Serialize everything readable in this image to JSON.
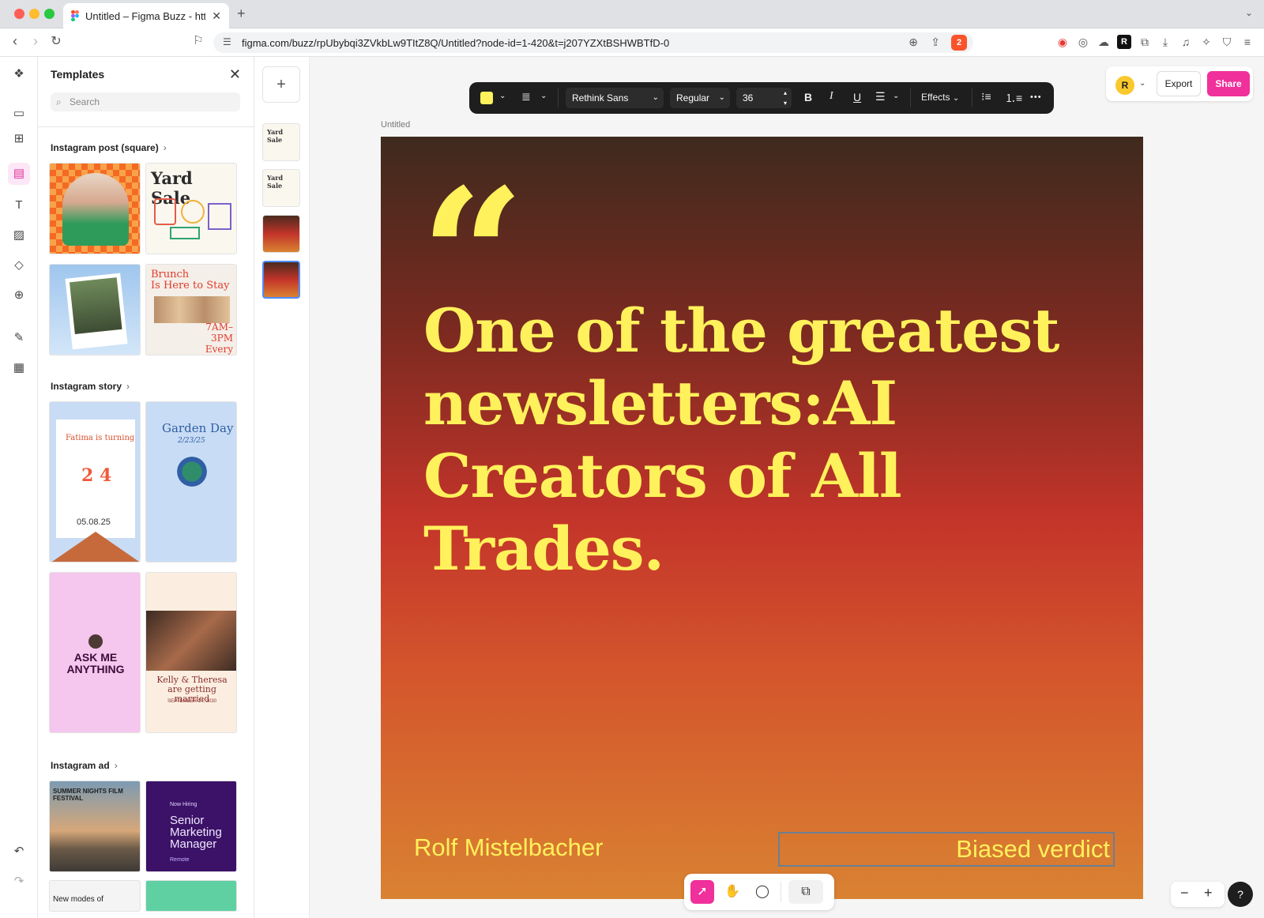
{
  "browser": {
    "tab_title": "Untitled – Figma Buzz - https",
    "url": "figma.com/buzz/rpUbybqi3ZVkbLw9TItZ8Q/Untitled?node-id=1-420&t=j207YZXtBSHWBTfD-0",
    "brave_badge": "2"
  },
  "templates_panel": {
    "title": "Templates",
    "search_placeholder": "Search",
    "sections": {
      "instagram_post": "Instagram post (square)",
      "instagram_story": "Instagram story",
      "instagram_ad": "Instagram ad"
    },
    "thumb_texts": {
      "yard_sale": "Yard Sale",
      "brunch_line1": "Brunch",
      "brunch_line2": "Is Here to Stay",
      "brunch_time": "7AM–3PM",
      "brunch_day": "Every Saturday",
      "fatima": "Fatima is turning",
      "fatima_age": "2 4",
      "fatima_date": "05.08.25",
      "garden_title": "Garden Day",
      "garden_date": "2/23/25",
      "ask_me": "ASK ME ANYTHING",
      "kelly": "Kelly & Theresa are getting married",
      "kelly_date": "SEPTEMBER 14, 2030",
      "film_festival": "SUMMER NIGHTS FILM FESTIVAL",
      "hiring": "Now Hiring",
      "senior": "Senior Marketing Manager",
      "remote": "Remote",
      "new_modes": "New modes of"
    }
  },
  "pages": {
    "thumb1": "Yard Sale",
    "thumb2": "Yard Sale"
  },
  "toolbar": {
    "font_family": "Rethink Sans",
    "font_weight": "Regular",
    "font_size": "36",
    "bold": "B",
    "italic": "I",
    "underline": "U",
    "effects": "Effects",
    "more": "•••"
  },
  "header_actions": {
    "avatar_initial": "R",
    "export": "Export",
    "share": "Share"
  },
  "frame": {
    "name": "Untitled",
    "quote_mark": "“",
    "headline": "One of the greatest newsletters:AI Creators of All Trades.",
    "author": "Rolf Mistelbacher",
    "verdict": "Biased verdict"
  },
  "zoom": {
    "minus": "−",
    "plus": "+"
  },
  "help": "?",
  "colors": {
    "accent_pink": "#f0309b",
    "text_yellow": "#fff15b"
  }
}
